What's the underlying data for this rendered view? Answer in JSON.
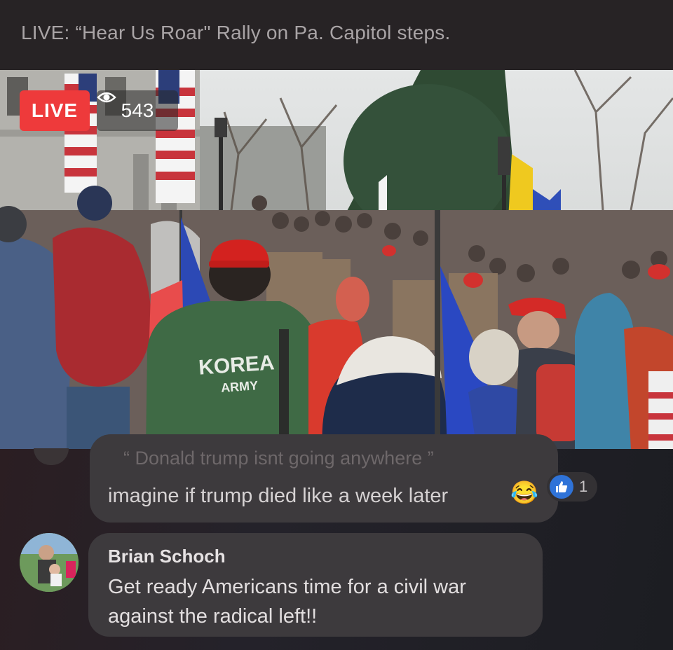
{
  "header": {
    "title": "LIVE: “Hear Us Roar\" Rally on Pa. Capitol steps."
  },
  "video": {
    "live_label": "LIVE",
    "viewer_count": "543",
    "jacket_text_1": "KOREA",
    "jacket_text_2": "ARMY"
  },
  "comments": [
    {
      "quoted_text": "“ Donald trump isnt going anywhere ”",
      "text": "imagine if trump died like a week later",
      "emoji": "😂",
      "reaction_count": "1"
    },
    {
      "author": "Brian Schoch",
      "text": "Get ready Americans time for a civil war against the radical left!!"
    }
  ],
  "colors": {
    "live_red": "#ee3a3b",
    "like_blue": "#2f73d8",
    "bubble_bg": "#3d3a3d"
  },
  "icons": {
    "viewers": "eye-icon",
    "reaction": "thumbs-up-icon"
  }
}
